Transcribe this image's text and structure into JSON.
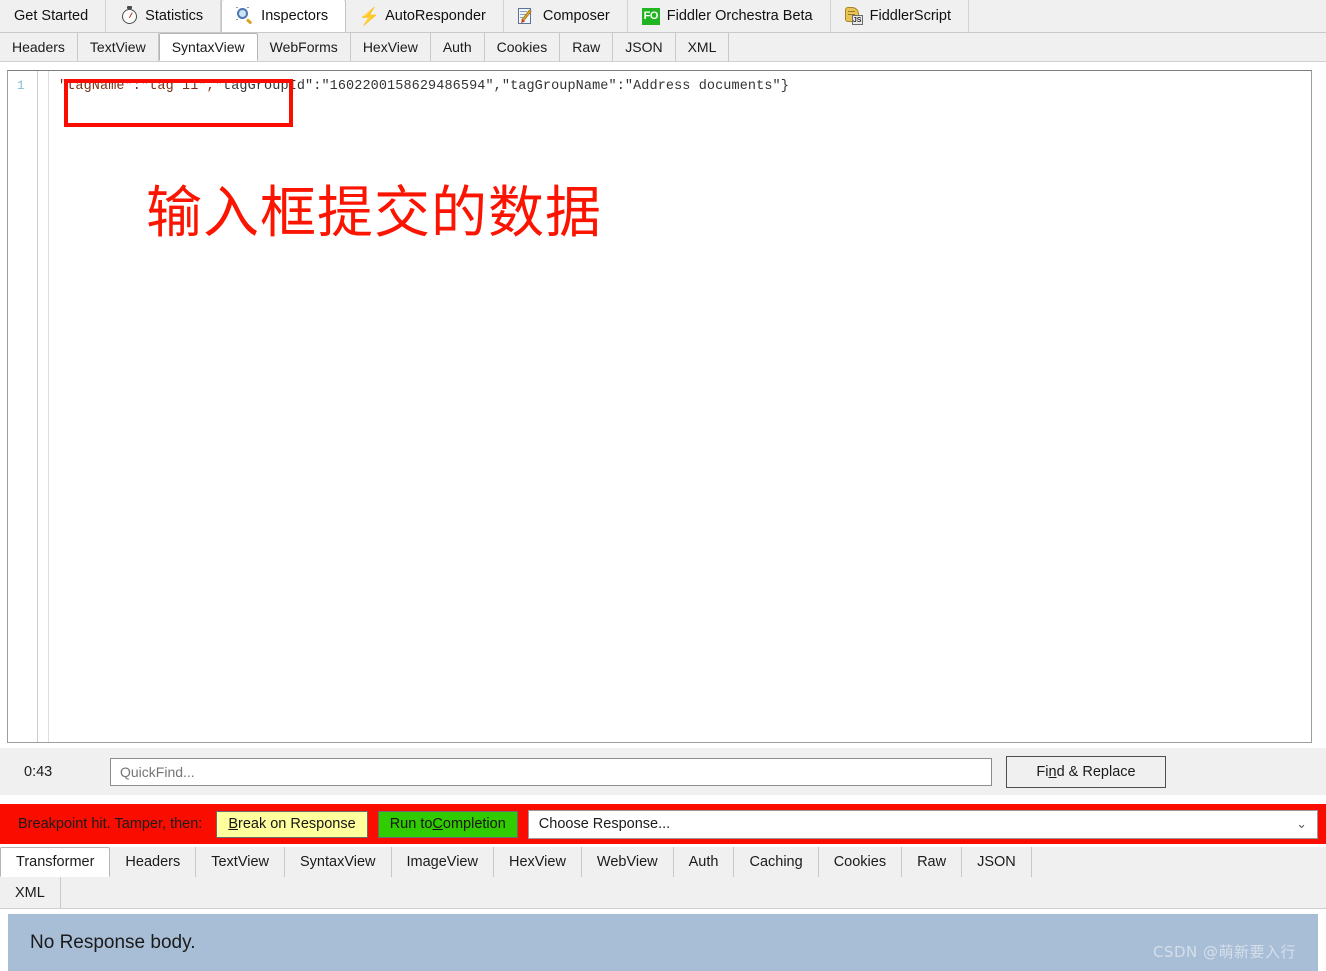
{
  "main_tabs": [
    {
      "label": "Get Started",
      "icon": "none",
      "active": false
    },
    {
      "label": "Statistics",
      "icon": "stopwatch",
      "active": false
    },
    {
      "label": "Inspectors",
      "icon": "magnifier",
      "active": true
    },
    {
      "label": "AutoResponder",
      "icon": "bolt",
      "active": false
    },
    {
      "label": "Composer",
      "icon": "composer",
      "active": false
    },
    {
      "label": "Fiddler Orchestra Beta",
      "icon": "fo-badge",
      "active": false
    },
    {
      "label": "FiddlerScript",
      "icon": "script",
      "active": false
    }
  ],
  "request_tabs": [
    {
      "label": "Headers",
      "active": false
    },
    {
      "label": "TextView",
      "active": false
    },
    {
      "label": "SyntaxView",
      "active": true
    },
    {
      "label": "WebForms",
      "active": false
    },
    {
      "label": "HexView",
      "active": false
    },
    {
      "label": "Auth",
      "active": false
    },
    {
      "label": "Cookies",
      "active": false
    },
    {
      "label": "Raw",
      "active": false
    },
    {
      "label": "JSON",
      "active": false
    },
    {
      "label": "XML",
      "active": false
    }
  ],
  "editor": {
    "line_number": "1",
    "code_prefix": "\"tagName\":\"tag 11\",",
    "code_suffix": "\"tagGroupId\":\"1602200158629486594\",\"tagGroupName\":\"Address documents\"}"
  },
  "annotations": {
    "caption_text": "输入框提交的数据",
    "highlight_color": "#fb0c00",
    "caption_color": "#fb1400"
  },
  "quickfind": {
    "timer": "0:43",
    "placeholder": "QuickFind...",
    "find_replace_pre": "Fi",
    "find_replace_underlined": "n",
    "find_replace_post": "d & Replace"
  },
  "breakpoint": {
    "message": "Breakpoint hit. Tamper, then:",
    "break_btn_underlined": "B",
    "break_btn_post": "reak on Response",
    "run_btn_pre": "Run to ",
    "run_btn_underlined": "C",
    "run_btn_post": "ompletion",
    "choose_response": "Choose Response...",
    "chevron": "⌄",
    "bar_color": "#fb0c00",
    "break_btn_color": "#ffff9e",
    "run_btn_color": "#31cc00"
  },
  "response_tabs_row1": [
    {
      "label": "Transformer",
      "active": true
    },
    {
      "label": "Headers",
      "active": false
    },
    {
      "label": "TextView",
      "active": false
    },
    {
      "label": "SyntaxView",
      "active": false
    },
    {
      "label": "ImageView",
      "active": false
    },
    {
      "label": "HexView",
      "active": false
    },
    {
      "label": "WebView",
      "active": false
    },
    {
      "label": "Auth",
      "active": false
    },
    {
      "label": "Caching",
      "active": false
    },
    {
      "label": "Cookies",
      "active": false
    },
    {
      "label": "Raw",
      "active": false
    },
    {
      "label": "JSON",
      "active": false
    }
  ],
  "response_tabs_row2": [
    {
      "label": "XML",
      "active": false
    }
  ],
  "response_body": {
    "message": "No Response body.",
    "background": "#a8bed6"
  },
  "watermark": "CSDN @萌新要入行"
}
